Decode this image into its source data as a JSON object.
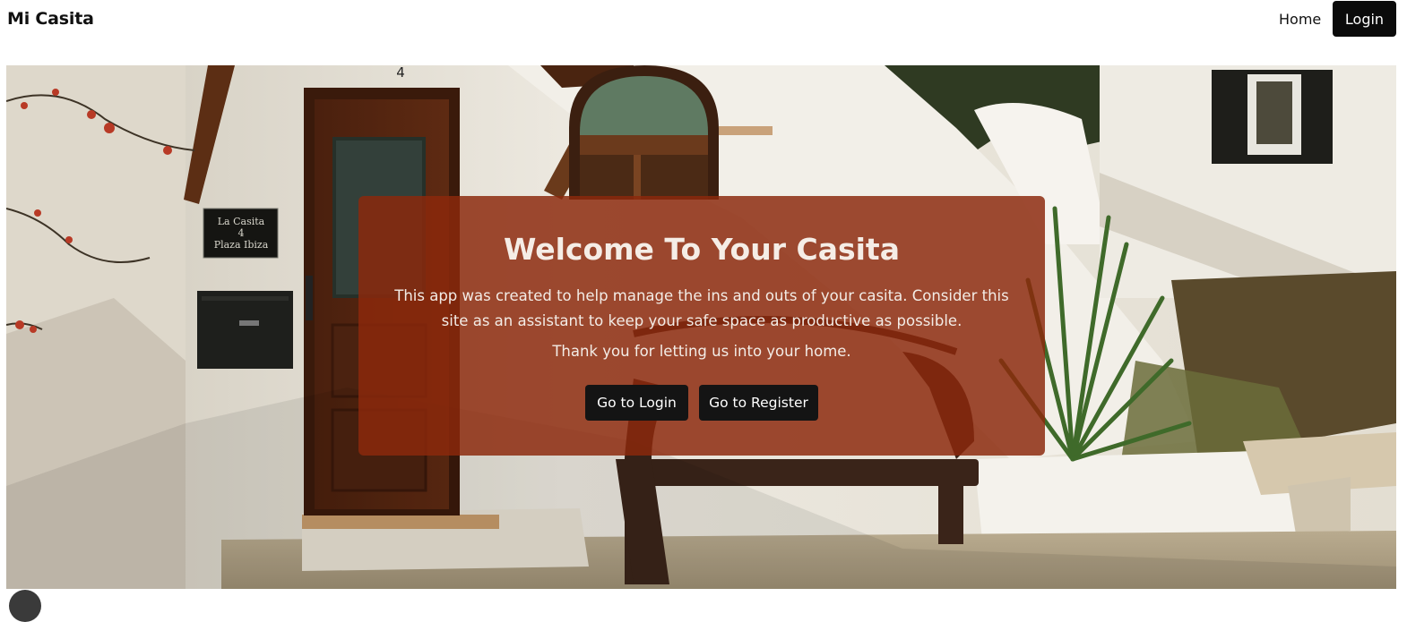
{
  "navbar": {
    "brand": "Mi Casita",
    "home_label": "Home",
    "login_label": "Login"
  },
  "hero": {
    "image_alt": "White Ibiza casita with wooden door, mailbox, plaque and wrought-iron bench",
    "plaque_lines": [
      "La Casita",
      "4",
      "Plaza Ibiza"
    ],
    "house_number": "4",
    "card": {
      "title": "Welcome To Your Casita",
      "description": "This app was created to help manage the ins and outs of your casita. Consider this site as an assistant to keep your safe space as productive as possible.",
      "thanks": "Thank you for letting us into your home.",
      "login_button": "Go to Login",
      "register_button": "Go to Register"
    }
  },
  "colors": {
    "card_overlay": "#8c280c",
    "button_dark": "#141414",
    "nav_login_bg": "#0b0b0b"
  }
}
